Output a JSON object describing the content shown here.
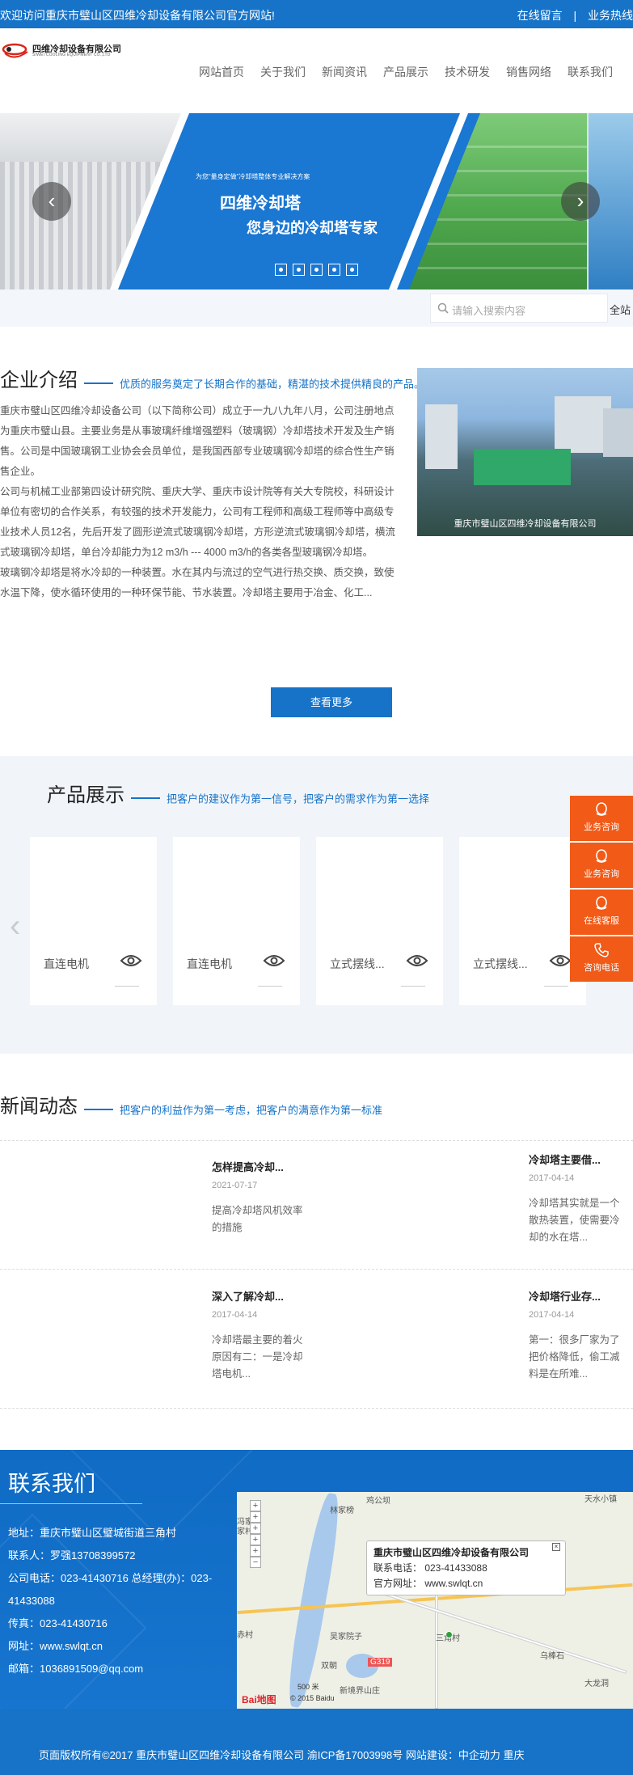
{
  "topbar": {
    "welcome": "欢迎访问重庆市璧山区四维冷却设备有限公司官方网站!",
    "online_message": "在线留言",
    "separator": "|",
    "hotline": "业务热线"
  },
  "header": {
    "logo_cn": "四维冷却设备有限公司",
    "logo_en": "SIWEI COOLING EQUIPMENT CO.,LTD",
    "nav": [
      "网站首页",
      "关于我们",
      "新闻资讯",
      "产品展示",
      "技术研发",
      "销售网络",
      "联系我们"
    ]
  },
  "banner": {
    "slogan_small": "为您“量身定做”冷却塔整体专业解决方案",
    "slogan_main": "四维冷却塔",
    "slogan_sub": "您身边的冷却塔专家",
    "prev": "‹",
    "next": "›",
    "slide_count": 5
  },
  "search": {
    "placeholder": "请输入搜索内容",
    "scope": "全站"
  },
  "company": {
    "title": "企业介绍",
    "subtitle": "优质的服务奠定了长期合作的基础，精湛的技术提供精良的产品。",
    "paragraphs": [
      "重庆市璧山区四维冷却设备公司（以下简称公司）成立于一九八九年八月，公司注册地点为重庆市璧山县。主要业务是从事玻璃纤维增强塑料（玻璃钢）冷却塔技术开发及生产销售。公司是中国玻璃钢工业协会会员单位，是我国西部专业玻璃钢冷却塔的综合性生产销售企业。",
      "公司与机械工业部第四设计研究院、重庆大学、重庆市设计院等有关大专院校，科研设计单位有密切的合作关系，有较强的技术开发能力，公司有工程师和高级工程师等中高级专业技术人员12名，先后开发了圆形逆流式玻璃钢冷却塔，方形逆流式玻璃钢冷却塔，横流式玻璃钢冷却塔，单台冷却能力为12 m3/h --- 4000 m3/h的各类各型玻璃钢冷却塔。",
      "玻璃钢冷却塔是将水冷却的一种装置。水在其内与流过的空气进行热交换、质交换，致使水温下降，使水循环使用的一种环保节能、节水装置。冷却塔主要用于冶金、化工..."
    ],
    "image_caption": "重庆市璧山区四维冷却设备有限公司",
    "more_button": "查看更多"
  },
  "products": {
    "title": "产品展示",
    "subtitle": "把客户的建议作为第一信号，把客户的需求作为第一选择",
    "prev": "‹",
    "items": [
      "直连电机",
      "直连电机",
      "立式摆线...",
      "立式摆线..."
    ]
  },
  "float_sidebar": [
    "业务咨询",
    "业务咨询",
    "在线客服",
    "咨询电话"
  ],
  "news": {
    "title": "新闻动态",
    "subtitle": "把客户的利益作为第一考虑，把客户的满意作为第一标准",
    "items": [
      {
        "title": "怎样提高冷却...",
        "date": "2021-07-17",
        "excerpt": "提高冷却塔风机效率的措施"
      },
      {
        "title": "冷却塔主要借...",
        "date": "2017-04-14",
        "excerpt": "冷却塔其实就是一个散热装置，使需要冷却的水在塔..."
      },
      {
        "title": "深入了解冷却...",
        "date": "2017-04-14",
        "excerpt": "冷却塔最主要的着火原因有二：一是冷却塔电机..."
      },
      {
        "title": "冷却塔行业存...",
        "date": "2017-04-14",
        "excerpt": "第一：很多厂家为了把价格降低，偷工减料是在所难..."
      }
    ]
  },
  "contact": {
    "title": "联系我们",
    "lines": [
      "地址：重庆市璧山区璧城街道三角村",
      "联系人：罗强13708399572",
      "公司电话：023-41430716 总经理(办)：023-41433088",
      "传真：023-41430716",
      "网址：www.swlqt.cn",
      "邮箱：1036891509@qq.com"
    ],
    "map": {
      "popup_title": "重庆市璧山区四维冷却设备有限公司",
      "popup_phone": "联系电话：  023-41433088",
      "popup_site": "官方网址：  www.swlqt.cn",
      "labels": [
        "林家榜",
        "鸡公坝",
        "天水小镇",
        "冯家岭",
        "吴家院子",
        "三角村",
        "双朝",
        "G319",
        "乌棒石",
        "新境界山庄",
        "大龙洞",
        "赤村",
        "家村"
      ],
      "scale": "500 米",
      "copyright": "© 2015 Baidu",
      "brand": "Bai地图"
    }
  },
  "footer": {
    "text": "页面版权所有©2017    重庆市璧山区四维冷却设备有限公司    渝ICP备17003998号    网站建设：中企动力 重庆"
  }
}
